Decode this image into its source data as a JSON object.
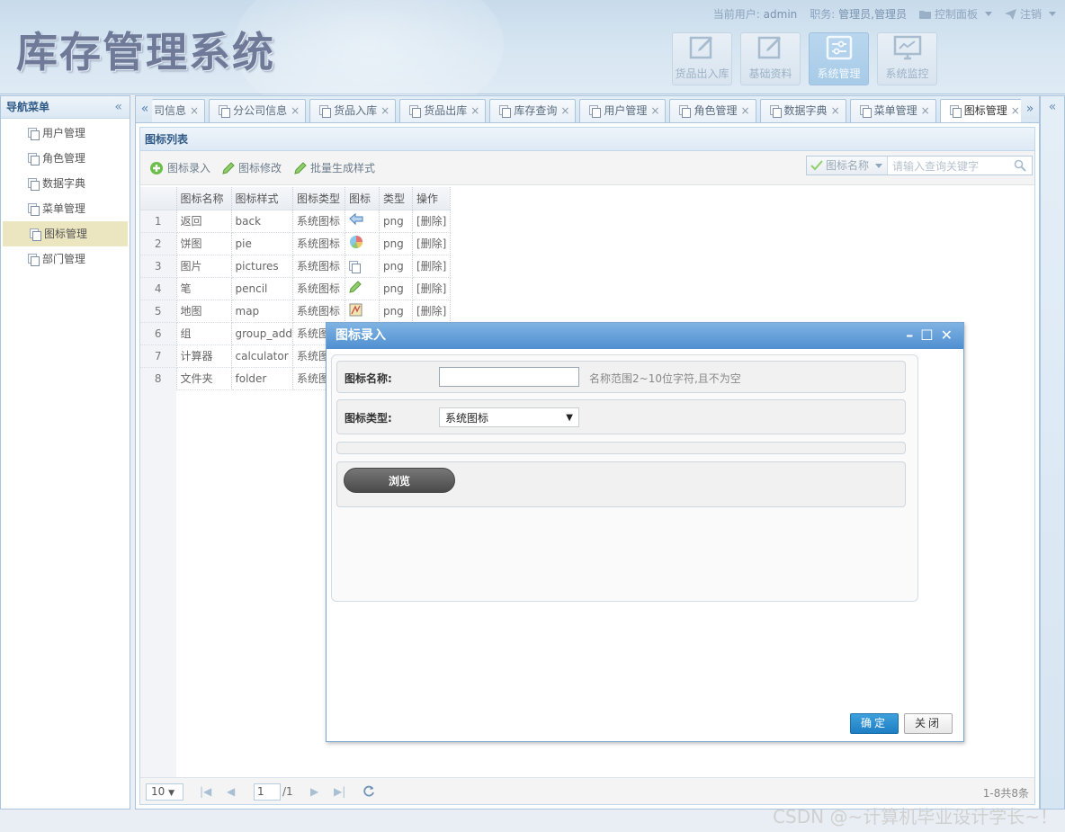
{
  "header": {
    "logo": "库存管理系统",
    "current_user_label": "当前用户:",
    "current_user": "admin",
    "role_label": "职务:",
    "role": "管理员,管理员",
    "control_panel": "控制面板",
    "logout": "注销",
    "top_buttons": [
      {
        "label": "货品出入库"
      },
      {
        "label": "基础资料"
      },
      {
        "label": "系统管理"
      },
      {
        "label": "系统监控"
      }
    ]
  },
  "sidebar": {
    "title": "导航菜单",
    "collapse_icon": "«",
    "items": [
      {
        "label": "用户管理"
      },
      {
        "label": "角色管理"
      },
      {
        "label": "数据字典"
      },
      {
        "label": "菜单管理"
      },
      {
        "label": "图标管理"
      },
      {
        "label": "部门管理"
      }
    ]
  },
  "tabs": {
    "scroll_left": "«",
    "scroll_right": "»",
    "items": [
      {
        "label": "司信息"
      },
      {
        "label": "分公司信息"
      },
      {
        "label": "货品入库"
      },
      {
        "label": "货品出库"
      },
      {
        "label": "库存查询"
      },
      {
        "label": "用户管理"
      },
      {
        "label": "角色管理"
      },
      {
        "label": "数据字典"
      },
      {
        "label": "菜单管理"
      },
      {
        "label": "图标管理"
      }
    ],
    "close_glyph": "×"
  },
  "list": {
    "title": "图标列表",
    "toolbar": {
      "add": "图标录入",
      "edit": "图标修改",
      "batch": "批量生成样式"
    },
    "search": {
      "field": "图标名称",
      "placeholder": "请输入查询关键字"
    },
    "columns": [
      "图标名称",
      "图标样式",
      "图标类型",
      "图标",
      "类型",
      "操作"
    ],
    "rows": [
      {
        "n": "1",
        "name": "返回",
        "style": "back",
        "type": "系统图标",
        "icon": "back-arrow-icon",
        "ext": "png",
        "op": "[删除]"
      },
      {
        "n": "2",
        "name": "饼图",
        "style": "pie",
        "type": "系统图标",
        "icon": "pie-chart-icon",
        "ext": "png",
        "op": "[删除]"
      },
      {
        "n": "3",
        "name": "图片",
        "style": "pictures",
        "type": "系统图标",
        "icon": "pictures-icon",
        "ext": "png",
        "op": "[删除]"
      },
      {
        "n": "4",
        "name": "笔",
        "style": "pencil",
        "type": "系统图标",
        "icon": "pencil-icon",
        "ext": "png",
        "op": "[删除]"
      },
      {
        "n": "5",
        "name": "地图",
        "style": "map",
        "type": "系统图标",
        "icon": "map-icon",
        "ext": "png",
        "op": "[删除]"
      },
      {
        "n": "6",
        "name": "组",
        "style": "group_add",
        "type": "系统图"
      },
      {
        "n": "7",
        "name": "计算器",
        "style": "calculator",
        "type": "系统图"
      },
      {
        "n": "8",
        "name": "文件夹",
        "style": "folder",
        "type": "系统图"
      }
    ],
    "pager": {
      "page_size": "10",
      "page": "1",
      "of_pages": "/1",
      "total": "1-8共8条"
    }
  },
  "dialog": {
    "title": "图标录入",
    "name_label": "图标名称:",
    "name_value": "",
    "name_hint": "名称范围2~10位字符,且不为空",
    "type_label": "图标类型:",
    "type_value": "系统图标",
    "browse": "浏览",
    "ok": "确定",
    "close": "关闭"
  },
  "watermark": "CSDN @~计算机毕业设计学长~！"
}
